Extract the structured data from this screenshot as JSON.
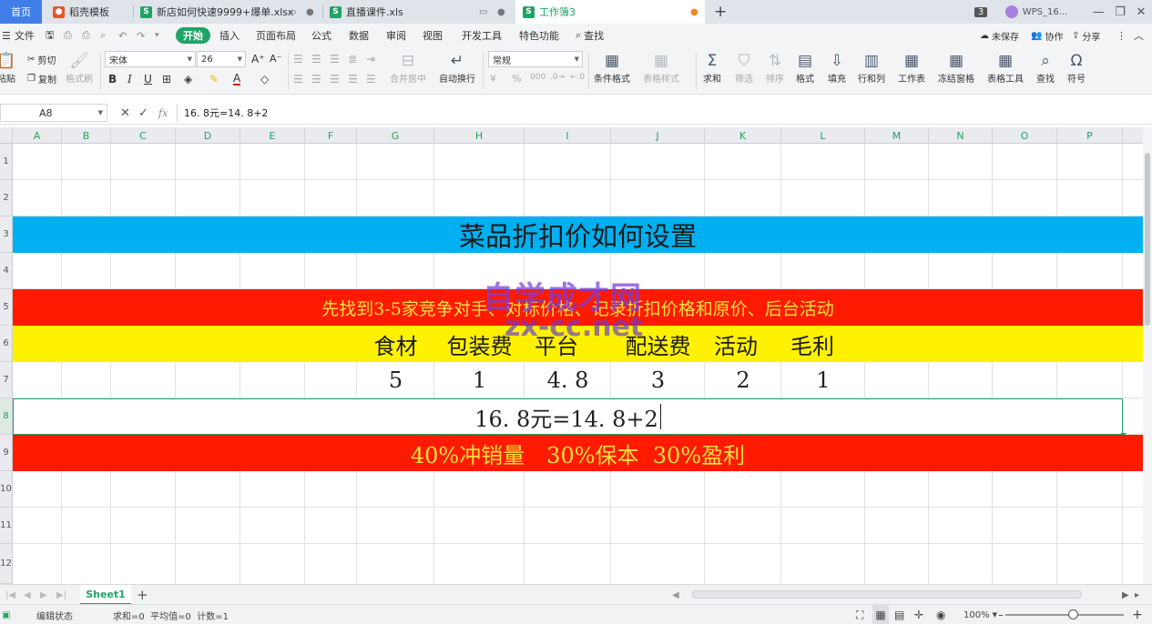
{
  "tabs": {
    "home": "首页",
    "items": [
      {
        "label": "稻壳模板",
        "icon": "docer-icon",
        "color": "#e8532f"
      },
      {
        "label": "新店如何快速9999+爆单.xlsx",
        "icon": "spreadsheet-icon",
        "color": "#21a366"
      },
      {
        "label": "直播课件.xls",
        "icon": "spreadsheet-icon",
        "color": "#21a366"
      },
      {
        "label": "工作簿3",
        "icon": "spreadsheet-icon",
        "color": "#21a366"
      }
    ],
    "window_count": "3",
    "account": "WPS_16..."
  },
  "menu": {
    "file": "文件",
    "items": [
      "开始",
      "插入",
      "页面布局",
      "公式",
      "数据",
      "审阅",
      "视图",
      "开发工具",
      "特色功能"
    ],
    "search": "查找",
    "unsaved": "未保存",
    "collaborate": "协作",
    "share": "分享"
  },
  "ribbon": {
    "paste": "粘贴",
    "cut": "剪切",
    "copy": "复制",
    "format_painter": "格式刷",
    "font_name": "宋体",
    "font_size": "26",
    "merge_center": "合并居中",
    "wrap_text": "自动换行",
    "number_format": "常规",
    "conditional_format": "条件格式",
    "table_style": "表格样式",
    "sum": "求和",
    "filter": "筛选",
    "sort": "排序",
    "format": "格式",
    "fill": "填充",
    "row_col": "行和列",
    "worksheet": "工作表",
    "freeze": "冻结窗格",
    "table_tools": "表格工具",
    "find": "查找",
    "symbol": "符号"
  },
  "formula_bar": {
    "cell_ref": "A8",
    "fx": "fx",
    "content": "16. 8元=14. 8+2"
  },
  "columns": [
    "A",
    "B",
    "C",
    "D",
    "E",
    "F",
    "G",
    "H",
    "I",
    "J",
    "K",
    "L",
    "M",
    "N",
    "O",
    "P"
  ],
  "rows": [
    "1",
    "2",
    "3",
    "4",
    "5",
    "6",
    "7",
    "8",
    "9",
    "10",
    "11",
    "12"
  ],
  "sheet": {
    "title": "菜品折扣价如何设置",
    "instruction": "先找到3-5家竞争对手、对标价格、记录折扣价格和原价、后台活动",
    "headers": [
      "食材",
      "包装费",
      "平台",
      "配送费",
      "活动",
      "毛利"
    ],
    "values": [
      "5",
      "1",
      "4. 8",
      "3",
      "2",
      "1"
    ],
    "formula_cell": "16. 8元=14. 8+2",
    "allocation": "40%冲销量　30%保本  30%盈利"
  },
  "watermark": {
    "line1": "自学成才网",
    "line2": "zx-cc.net"
  },
  "sheet_tabs": {
    "active": "Sheet1"
  },
  "status": {
    "mode": "编辑状态",
    "stats": "求和=0  平均值=0  计数=1",
    "zoom": "100%"
  },
  "colors": {
    "accent": "#21a366",
    "title_band": "#00b0f0",
    "red_band": "#ff1a00",
    "yellow_band": "#fff200",
    "band_text_yellow": "#ffe23d"
  }
}
